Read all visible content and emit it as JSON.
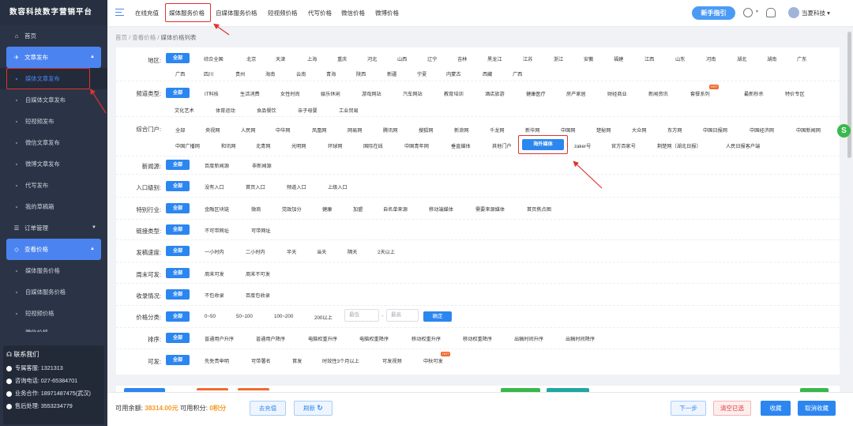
{
  "app": {
    "title": "数容科技数字营销平台"
  },
  "sidebar": {
    "home": "首页",
    "article_group": "文章发布",
    "article_items": [
      "媒体文章发布",
      "自媒体文章发布",
      "短视频发布",
      "微信文章发布",
      "微博文章发布",
      "代写发布",
      "我的草稿箱"
    ],
    "order_group": "订单管理",
    "price_group": "查看价格",
    "price_items": [
      "媒体服务价格",
      "自媒体服务价格",
      "短视频价格",
      "微信价格"
    ],
    "contact": {
      "title": "联系我们",
      "lines": [
        "专属客服: 1321313",
        "咨询电话: 027-65384701",
        "业务合作: 18971487475(武汉)",
        "售后处理: 3553234779"
      ]
    }
  },
  "topnav": {
    "items": [
      "在线充值",
      "媒体服务价格",
      "自媒体服务价格",
      "短视频价格",
      "代写价格",
      "微信价格",
      "微博价格"
    ],
    "guide": "新手指引",
    "user": "当夏科技"
  },
  "breadcrumb": [
    "首页",
    "查看价格",
    "媒体价格列表"
  ],
  "filters": {
    "region": {
      "label": "地区:",
      "row1": [
        "全部",
        "综合全国",
        "北京",
        "天津",
        "上海",
        "重庆",
        "河北",
        "山西",
        "辽宁",
        "吉林",
        "黑龙江",
        "江苏",
        "浙江",
        "安徽",
        "福建",
        "江西",
        "山东",
        "河南",
        "湖北",
        "湖南",
        "广东"
      ],
      "row2": [
        "广西",
        "四川",
        "贵州",
        "海南",
        "云南",
        "青海",
        "陕西",
        "新疆",
        "宁夏",
        "内蒙古",
        "西藏",
        "广西"
      ]
    },
    "channel": {
      "label": "频道类型:",
      "row1": [
        "全部",
        "IT科技",
        "生活消费",
        "女性时尚",
        "娱乐休闲",
        "游戏网站",
        "汽车网站",
        "教育培训",
        "酒店旅游",
        "健康医疗",
        "房产家居",
        "财经商业",
        "新闻资讯",
        "套餐系列",
        "最新秒杀",
        "特价专区"
      ],
      "row2": [
        "文化艺术",
        "体育运动",
        "食品餐饮",
        "亲子母婴",
        "工业贸易"
      ],
      "hot": "HOT"
    },
    "portal": {
      "label": "综合门户:",
      "row1": [
        "全部",
        "央视网",
        "人民网",
        "中华网",
        "凤凰网",
        "网易网",
        "腾讯网",
        "搜狐网",
        "新浪网",
        "千龙网",
        "新华网",
        "中国网",
        "楚秘网",
        "大众网",
        "东方网",
        "中国日报网",
        "中国经济网",
        "中国新闻网"
      ],
      "row2": [
        "中国广播网",
        "和讯网",
        "北青网",
        "光明网",
        "环球网",
        "国际在线",
        "中国青年网",
        "垂直媒体",
        "其他门户",
        "海外媒体",
        "zaker号",
        "官方百家号",
        "荆楚网（湖北日报）",
        "人民日报客户端"
      ]
    },
    "news": {
      "label": "新闻源:",
      "opts": [
        "全部",
        "百度新闻源",
        "非新闻源"
      ]
    },
    "entry": {
      "label": "入口级别:",
      "opts": [
        "全部",
        "没有入口",
        "首页入口",
        "频道入口",
        "上级入口"
      ]
    },
    "industry": {
      "label": "特别行业:",
      "opts": [
        "全部",
        "金融区块链",
        "微商",
        "党政加分",
        "健康",
        "加盟",
        "自名单来源",
        "移动端媒体",
        "需要来源媒体",
        "首页焦点图"
      ]
    },
    "link": {
      "label": "链接类型:",
      "opts": [
        "全部",
        "不可带网址",
        "可带网址"
      ]
    },
    "speed": {
      "label": "发稿速度:",
      "opts": [
        "全部",
        "一小时内",
        "二小时内",
        "半天",
        "当天",
        "隔天",
        "2天以上"
      ]
    },
    "weekend": {
      "label": "周末可发:",
      "opts": [
        "全部",
        "周末可发",
        "周末不可发"
      ]
    },
    "index": {
      "label": "收录情况:",
      "opts": [
        "全部",
        "不包收录",
        "百度包收录"
      ]
    },
    "price": {
      "label": "价格分类:",
      "opts": [
        "全部",
        "0~50",
        "50~100",
        "100~200",
        "200以上"
      ],
      "min": "最低",
      "max": "最高",
      "dash": "-",
      "ok": "确定"
    },
    "sort": {
      "label": "排序:",
      "opts": [
        "全部",
        "普通用户升序",
        "普通用户降序",
        "电脑权重升序",
        "电脑权重降序",
        "移动权重升序",
        "移动权重降序",
        "出稿时间升序",
        "出稿时间降序"
      ]
    },
    "allow": {
      "label": "可发:",
      "opts": [
        "全部",
        "先免责申明",
        "可带署名",
        "首发",
        "时效性3个月以上",
        "可发视频",
        "中秋可发"
      ],
      "hot": "HOT"
    }
  },
  "footer": {
    "balance_label": "可用余额:",
    "balance": "38314.00元",
    "points_label": "可用积分:",
    "points": "0积分",
    "recharge": "去充值",
    "refresh": "刷新",
    "next": "下一步",
    "clear": "清空已选",
    "favorite": "收藏",
    "unfavorite": "取消收藏"
  },
  "colors": {
    "accent": "#2c86f0",
    "highlight": "#e0322f",
    "sidebar": "#2b3446",
    "balance": "#f59a23"
  }
}
